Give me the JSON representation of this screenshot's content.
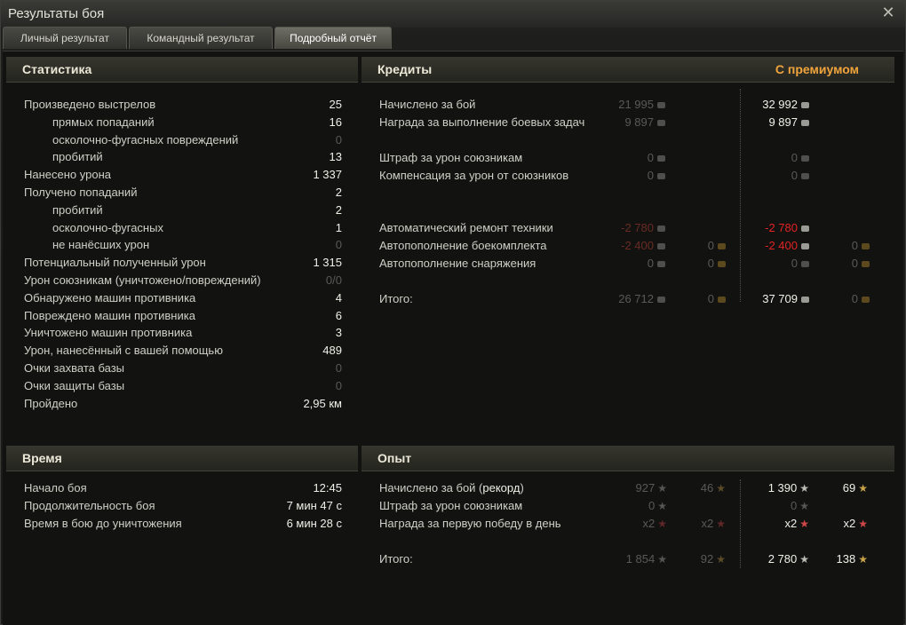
{
  "window": {
    "title": "Результаты боя",
    "close_icon": "close-icon"
  },
  "tabs": [
    {
      "label": "Личный результат",
      "active": false
    },
    {
      "label": "Командный результат",
      "active": false
    },
    {
      "label": "Подробный отчёт",
      "active": true
    }
  ],
  "statistics": {
    "title": "Статистика",
    "rows": [
      {
        "label": "Произведено выстрелов",
        "value": "25",
        "indent": false,
        "dim": false
      },
      {
        "label": "прямых попаданий",
        "value": "16",
        "indent": true,
        "dim": false
      },
      {
        "label": "осколочно-фугасных повреждений",
        "value": "0",
        "indent": true,
        "dim": true
      },
      {
        "label": "пробитий",
        "value": "13",
        "indent": true,
        "dim": false
      },
      {
        "label": "Нанесено урона",
        "value": "1 337",
        "indent": false,
        "dim": false
      },
      {
        "label": "Получено попаданий",
        "value": "2",
        "indent": false,
        "dim": false
      },
      {
        "label": "пробитий",
        "value": "2",
        "indent": true,
        "dim": false
      },
      {
        "label": "осколочно-фугасных",
        "value": "1",
        "indent": true,
        "dim": false
      },
      {
        "label": "не нанёсших урон",
        "value": "0",
        "indent": true,
        "dim": true
      },
      {
        "label": "Потенциальный полученный урон",
        "value": "1 315",
        "indent": false,
        "dim": false
      },
      {
        "label": "Урон союзникам (уничтожено/повреждений)",
        "value": "0/0",
        "indent": false,
        "dim": true
      },
      {
        "label": "Обнаружено машин противника",
        "value": "4",
        "indent": false,
        "dim": false
      },
      {
        "label": "Повреждено машин противника",
        "value": "6",
        "indent": false,
        "dim": false
      },
      {
        "label": "Уничтожено машин противника",
        "value": "3",
        "indent": false,
        "dim": false
      },
      {
        "label": "Урон, нанесённый с вашей помощью",
        "value": "489",
        "indent": false,
        "dim": false
      },
      {
        "label": "Очки захвата базы",
        "value": "0",
        "indent": false,
        "dim": true
      },
      {
        "label": "Очки защиты базы",
        "value": "0",
        "indent": false,
        "dim": true
      },
      {
        "label": "Пройдено",
        "value": "2,95 км",
        "indent": false,
        "dim": false
      }
    ]
  },
  "credits": {
    "title": "Кредиты",
    "premium_title": "С премиумом",
    "rows": [
      {
        "label": "Начислено за бой",
        "base": "21 995",
        "base_gold": "",
        "prem": "32 992",
        "prem_gold": "",
        "style": "normal"
      },
      {
        "label": "Награда за выполнение боевых задач",
        "base": "9 897",
        "base_gold": "",
        "prem": "9 897",
        "prem_gold": "",
        "style": "normal"
      },
      {
        "label": "Штраф за урон союзникам",
        "base": "0",
        "base_gold": "",
        "prem": "0",
        "prem_gold": "",
        "style": "zero"
      },
      {
        "label": "Компенсация за урон от союзников",
        "base": "0",
        "base_gold": "",
        "prem": "0",
        "prem_gold": "",
        "style": "zero"
      },
      {
        "label": "Автоматический ремонт техники",
        "base": "-2 780",
        "base_gold": "",
        "prem": "-2 780",
        "prem_gold": "",
        "style": "red"
      },
      {
        "label": "Автопополнение боекомплекта",
        "base": "-2 400",
        "base_gold": "0",
        "prem": "-2 400",
        "prem_gold": "0",
        "style": "red"
      },
      {
        "label": "Автопополнение снаряжения",
        "base": "0",
        "base_gold": "0",
        "prem": "0",
        "prem_gold": "0",
        "style": "zero"
      },
      {
        "label": "Итого:",
        "base": "26 712",
        "base_gold": "0",
        "prem": "37 709",
        "prem_gold": "0",
        "style": "total"
      }
    ]
  },
  "time": {
    "title": "Время",
    "rows": [
      {
        "label": "Начало боя",
        "value": "12:45"
      },
      {
        "label": "Продолжительность боя",
        "value": "7 мин 47 с"
      },
      {
        "label": "Время в бою до уничтожения",
        "value": "6 мин 28 с"
      }
    ]
  },
  "experience": {
    "title": "Опыт",
    "rows": [
      {
        "label": "Начислено за бой (",
        "label_bold": "рекорд",
        "label_end": ")",
        "base": "927",
        "base_free": "46",
        "prem": "1 390",
        "prem_free": "69",
        "style": "normal"
      },
      {
        "label": "Штраф за урон союзникам",
        "label_bold": "",
        "label_end": "",
        "base": "0",
        "base_free": "",
        "prem": "0",
        "prem_free": "",
        "style": "zero"
      },
      {
        "label": "Награда за первую победу в день",
        "label_bold": "",
        "label_end": "",
        "base": "x2",
        "base_free": "x2",
        "prem": "x2",
        "prem_free": "x2",
        "style": "mult"
      },
      {
        "label": "Итого:",
        "label_bold": "",
        "label_end": "",
        "base": "1 854",
        "base_free": "92",
        "prem": "2 780",
        "prem_free": "138",
        "style": "total"
      }
    ]
  }
}
